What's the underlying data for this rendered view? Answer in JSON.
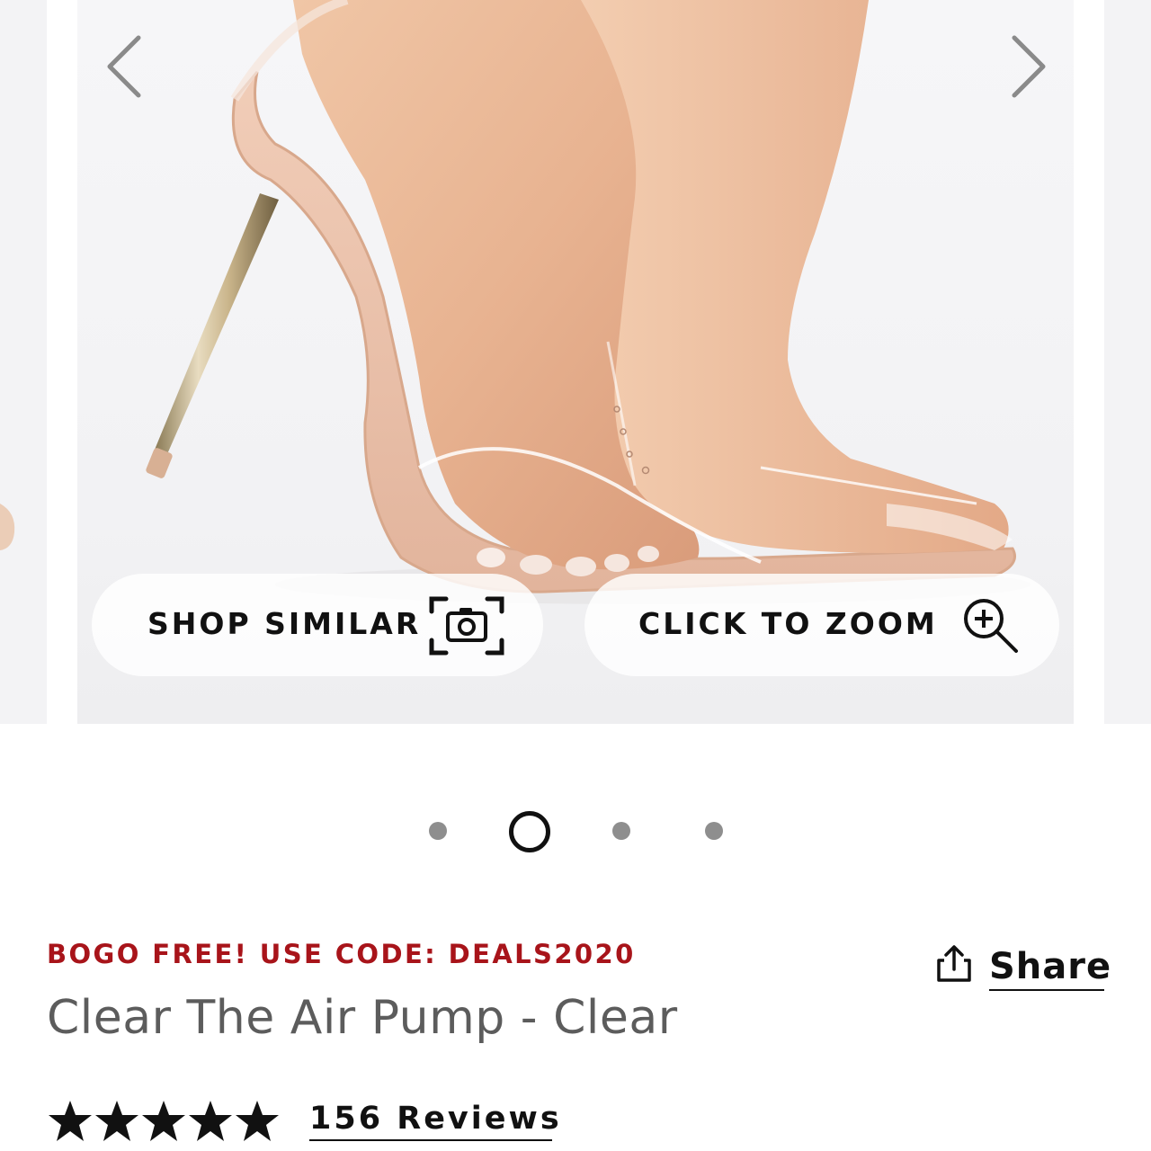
{
  "gallery": {
    "product_image": "clear-pump-heel-photo",
    "prev_icon": "chevron-left-icon",
    "next_icon": "chevron-right-icon",
    "shop_similar_label": "SHOP SIMILAR",
    "shop_similar_icon": "camera-scan-icon",
    "zoom_label": "CLICK TO ZOOM",
    "zoom_icon": "zoom-in-icon"
  },
  "pagination": {
    "total": 4,
    "active_index": 1
  },
  "product": {
    "promo": "BOGO FREE! USE CODE: DEALS2020",
    "title": "Clear The Air Pump - Clear",
    "share_label": "Share",
    "share_icon": "share-icon",
    "rating": 5,
    "reviews_label": "156 Reviews"
  },
  "colors": {
    "promo_red": "#a8141a",
    "title_gray": "#5c5c5c",
    "dot_gray": "#8e8e8e",
    "text_black": "#111111"
  }
}
